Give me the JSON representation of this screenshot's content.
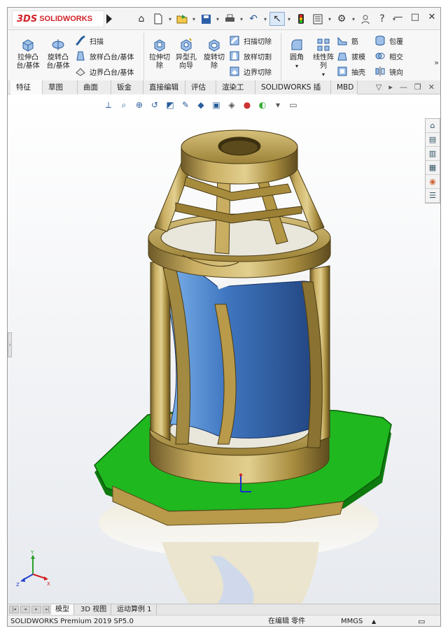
{
  "app": {
    "logo_mark": "3DS",
    "logo_text": "SOLIDWORKS",
    "title_arrow_icon": "play-triangle-icon"
  },
  "quick_access": [
    "home-icon",
    "new-document-icon",
    "open-icon",
    "save-icon",
    "print-icon",
    "undo-icon",
    "select-icon",
    "rebuild-icon",
    "file-properties-icon",
    "options-icon",
    "user-icon",
    "help-icon",
    "minimize-icon",
    "restore-icon"
  ],
  "window_controls": {
    "minimize": "—",
    "restore": "□",
    "close": "✕"
  },
  "ribbon": {
    "extrude_boss": "拉伸凸\n台/基体",
    "revolve_boss": "旋转凸\n台/基体",
    "sweep": "扫描",
    "loft_boss": "放样凸台/基体",
    "boundary_boss": "边界凸台/基体",
    "extrude_cut": "拉伸切\n除",
    "hole_wizard": "异型孔\n向导",
    "revolve_cut": "旋转切\n除",
    "sweep_cut": "扫描切除",
    "loft_cut": "放样切割",
    "boundary_cut": "边界切除",
    "fillet": "圆角",
    "linear_pattern": "线性阵\n列",
    "rib": "筋",
    "draft": "拔模",
    "shell": "抽壳",
    "wrap": "包覆",
    "intersect": "相交",
    "mirror": "镜向",
    "more": "»"
  },
  "tabs": [
    "特征",
    "草图",
    "曲面",
    "钣金",
    "直接编辑",
    "评估",
    "渲染工具",
    "SOLIDWORKS 插件",
    "MBD"
  ],
  "viewport": {
    "hud_icons": [
      "view-orientation-icon",
      "zoom-to-fit-icon",
      "zoom-area-icon",
      "previous-view-icon",
      "section-view-icon",
      "dynamic-annotation-icon",
      "view-cube-icon",
      "display-style-icon",
      "hide-show-icon",
      "edit-appearance-icon",
      "apply-scene-icon",
      "view-settings-icon",
      "monitor-icon"
    ],
    "task_pane_icons": [
      "home-icon",
      "resources-icon",
      "design-library-icon",
      "file-explorer-icon",
      "appearances-icon",
      "custom-properties-icon"
    ],
    "triad": {
      "x": "X",
      "y": "Y",
      "z": "Z"
    },
    "colors": {
      "brass": "#b89a4a",
      "blue_insert": "#3f6fb5",
      "green_base": "#1fb81f"
    }
  },
  "bottom_tabs": [
    "模型",
    "3D 视图",
    "运动算例 1"
  ],
  "status": {
    "product": "SOLIDWORKS Premium 2019 SP5.0",
    "editing": "在编辑 零件",
    "units": "MMGS",
    "units_arrow": "▲",
    "comment_icon": "comment-icon"
  }
}
